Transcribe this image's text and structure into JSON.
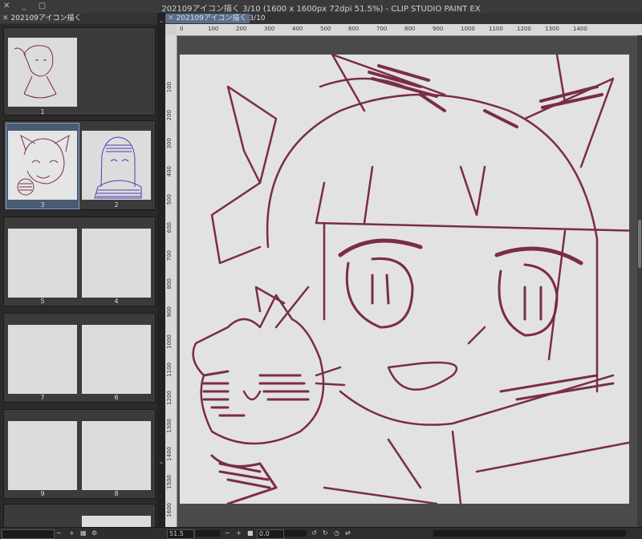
{
  "window": {
    "title": "202109アイコン描く 3/10 (1600 x 1600px 72dpi 51.5%)  - CLIP STUDIO PAINT EX",
    "controls": "✕ _ ▢"
  },
  "tabs": {
    "left": "202109アイコン描く",
    "right": "202109アイコン描く 3/10"
  },
  "pages": {
    "p1": "1",
    "p2": "2",
    "p3": "3",
    "p4": "4",
    "p5": "5",
    "p6": "6",
    "p7": "7",
    "p8": "8",
    "p9": "9"
  },
  "ruler": {
    "h": [
      "0",
      "100",
      "200",
      "300",
      "400",
      "500",
      "600",
      "700",
      "800",
      "900",
      "1000",
      "1100",
      "1200",
      "1300",
      "1400"
    ],
    "v": [
      "100",
      "200",
      "300",
      "400",
      "500",
      "600",
      "700",
      "800",
      "900",
      "1000",
      "1100",
      "1200",
      "1300",
      "1400",
      "1500",
      "1600"
    ]
  },
  "status": {
    "zoom": "51.5",
    "angle": "0.0"
  },
  "colors": {
    "sketch": "#7a2d45",
    "selected_border": "#8aa0c4"
  }
}
